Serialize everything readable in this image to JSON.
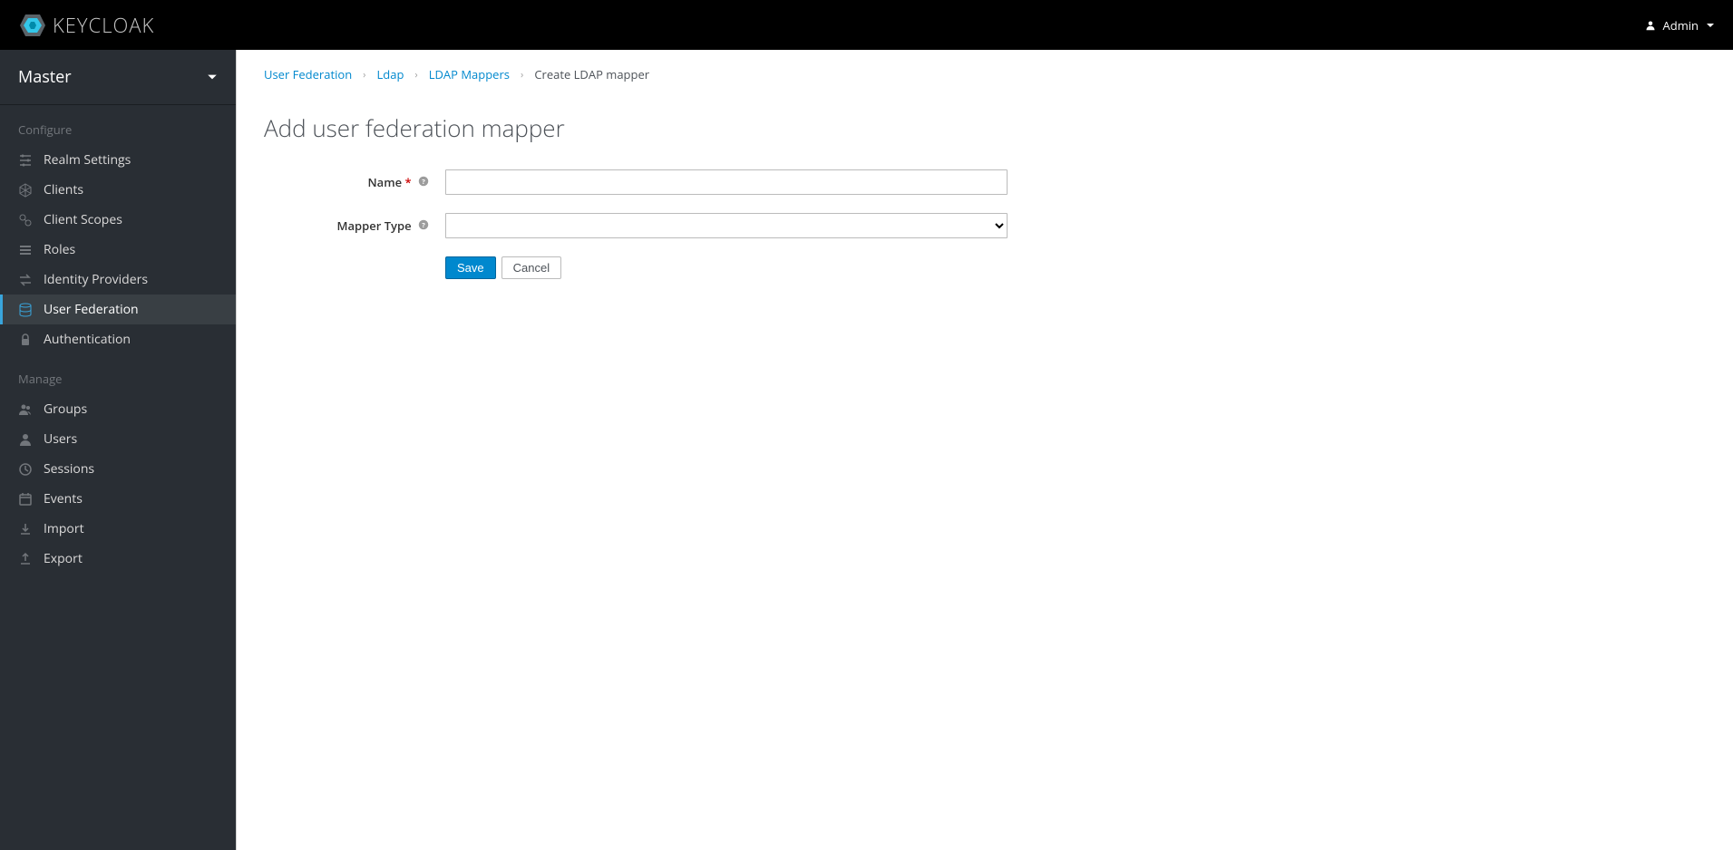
{
  "header": {
    "brand": "KEYCLOAK",
    "user": "Admin"
  },
  "sidebar": {
    "realm": "Master",
    "sections": [
      {
        "title": "Configure",
        "items": [
          {
            "label": "Realm Settings",
            "icon": "sliders"
          },
          {
            "label": "Clients",
            "icon": "cube"
          },
          {
            "label": "Client Scopes",
            "icon": "scopes"
          },
          {
            "label": "Roles",
            "icon": "list"
          },
          {
            "label": "Identity Providers",
            "icon": "exchange"
          },
          {
            "label": "User Federation",
            "icon": "database",
            "active": true
          },
          {
            "label": "Authentication",
            "icon": "lock"
          }
        ]
      },
      {
        "title": "Manage",
        "items": [
          {
            "label": "Groups",
            "icon": "users"
          },
          {
            "label": "Users",
            "icon": "user"
          },
          {
            "label": "Sessions",
            "icon": "clock"
          },
          {
            "label": "Events",
            "icon": "calendar"
          },
          {
            "label": "Import",
            "icon": "import"
          },
          {
            "label": "Export",
            "icon": "export"
          }
        ]
      }
    ]
  },
  "breadcrumb": {
    "items": [
      {
        "label": "User Federation",
        "link": true
      },
      {
        "label": "Ldap",
        "link": true
      },
      {
        "label": "LDAP Mappers",
        "link": true
      },
      {
        "label": "Create LDAP mapper",
        "link": false
      }
    ]
  },
  "page": {
    "title": "Add user federation mapper"
  },
  "form": {
    "name_label": "Name",
    "name_value": "",
    "mapper_type_label": "Mapper Type",
    "mapper_type_value": "",
    "save_label": "Save",
    "cancel_label": "Cancel"
  }
}
